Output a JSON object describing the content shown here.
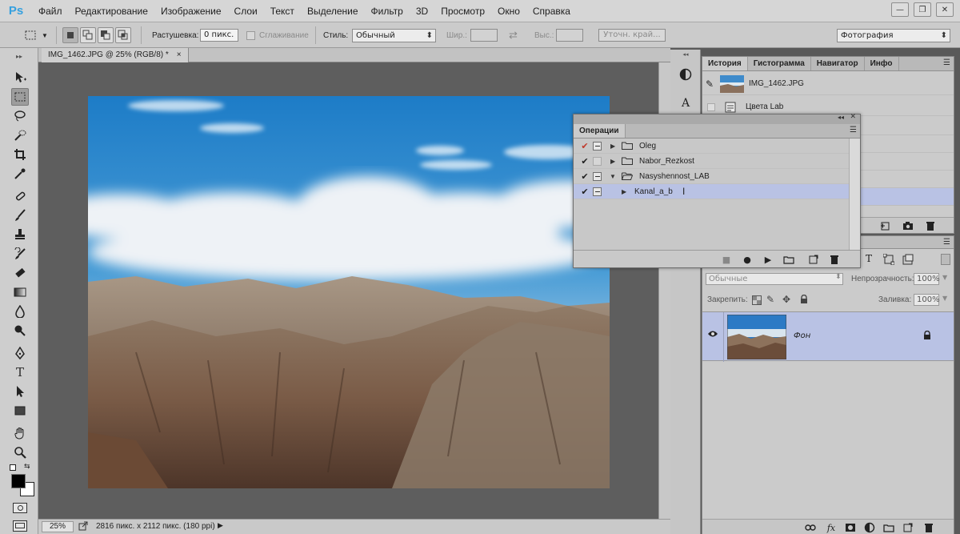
{
  "app": {
    "logo": "Ps"
  },
  "menu": [
    "Файл",
    "Редактирование",
    "Изображение",
    "Слои",
    "Текст",
    "Выделение",
    "Фильтр",
    "3D",
    "Просмотр",
    "Окно",
    "Справка"
  ],
  "window_controls": {
    "minimize": "—",
    "restore": "❐",
    "close": "✕"
  },
  "options": {
    "feather_label": "Растушевка:",
    "feather_value": "0 пикс.",
    "antialias_label": "Сглаживание",
    "style_label": "Стиль:",
    "style_value": "Обычный",
    "width_label": "Шир.:",
    "height_label": "Выс.:",
    "refine_edge": "Уточн. край...",
    "workspace": "Фотография"
  },
  "document": {
    "tab_title": "IMG_1462.JPG @ 25% (RGB/8) *",
    "tab_close": "×",
    "zoom": "25%",
    "status_info": "2816 пикс. x 2112 пикс. (180 ppi)"
  },
  "history_panel": {
    "tabs": [
      "История",
      "Гистограмма",
      "Навигатор",
      "Инфо"
    ],
    "snapshot": "IMG_1462.JPG",
    "items": [
      "Цвета Lab"
    ]
  },
  "actions_panel": {
    "title": "Операции",
    "items": [
      {
        "name": "Oleg",
        "check": "✔",
        "check_color": "#c0392b",
        "type": "set",
        "expanded": false,
        "dialog": true
      },
      {
        "name": "Nabor_Rezkost",
        "check": "✔",
        "check_color": "#1e1e1e",
        "type": "set",
        "expanded": false,
        "dialog": false
      },
      {
        "name": "Nasyshennost_LAB",
        "check": "✔",
        "check_color": "#1e1e1e",
        "type": "set",
        "expanded": true,
        "dialog": true
      },
      {
        "name": "Kanal_a_b",
        "check": "✔",
        "check_color": "#1e1e1e",
        "type": "action",
        "expanded": false,
        "dialog": true,
        "selected": true
      }
    ]
  },
  "layers_panel": {
    "blend_mode": "Обычные",
    "opacity_label": "Непрозрачность:",
    "opacity_value": "100%",
    "lock_label": "Закрепить:",
    "fill_label": "Заливка:",
    "fill_value": "100%",
    "layers": [
      {
        "name": "Фон",
        "locked": true,
        "visible": true
      }
    ]
  },
  "colors": {
    "accent_selection": "#b9c2e4",
    "ps_blue": "#35a0df"
  }
}
